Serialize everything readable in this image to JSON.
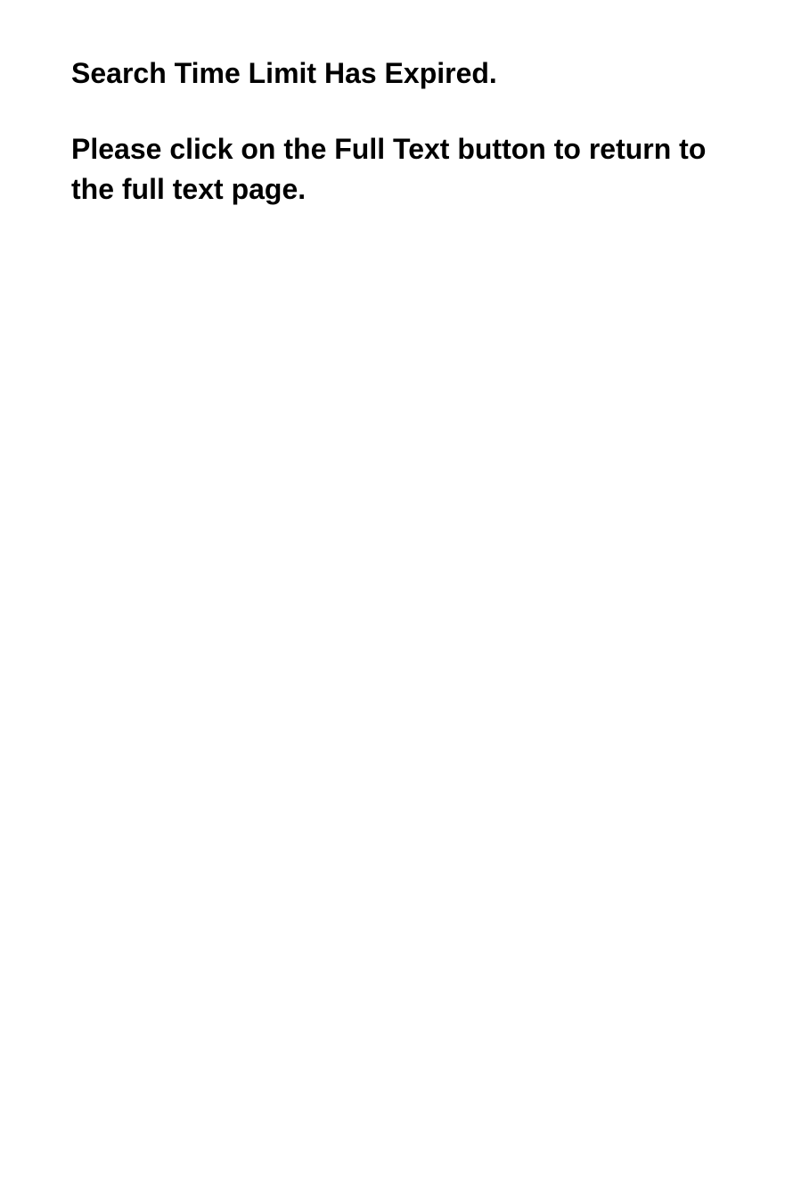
{
  "message": {
    "heading": "Search Time Limit Has Expired.",
    "instruction": "Please click on the Full Text button to return to the full text page."
  }
}
